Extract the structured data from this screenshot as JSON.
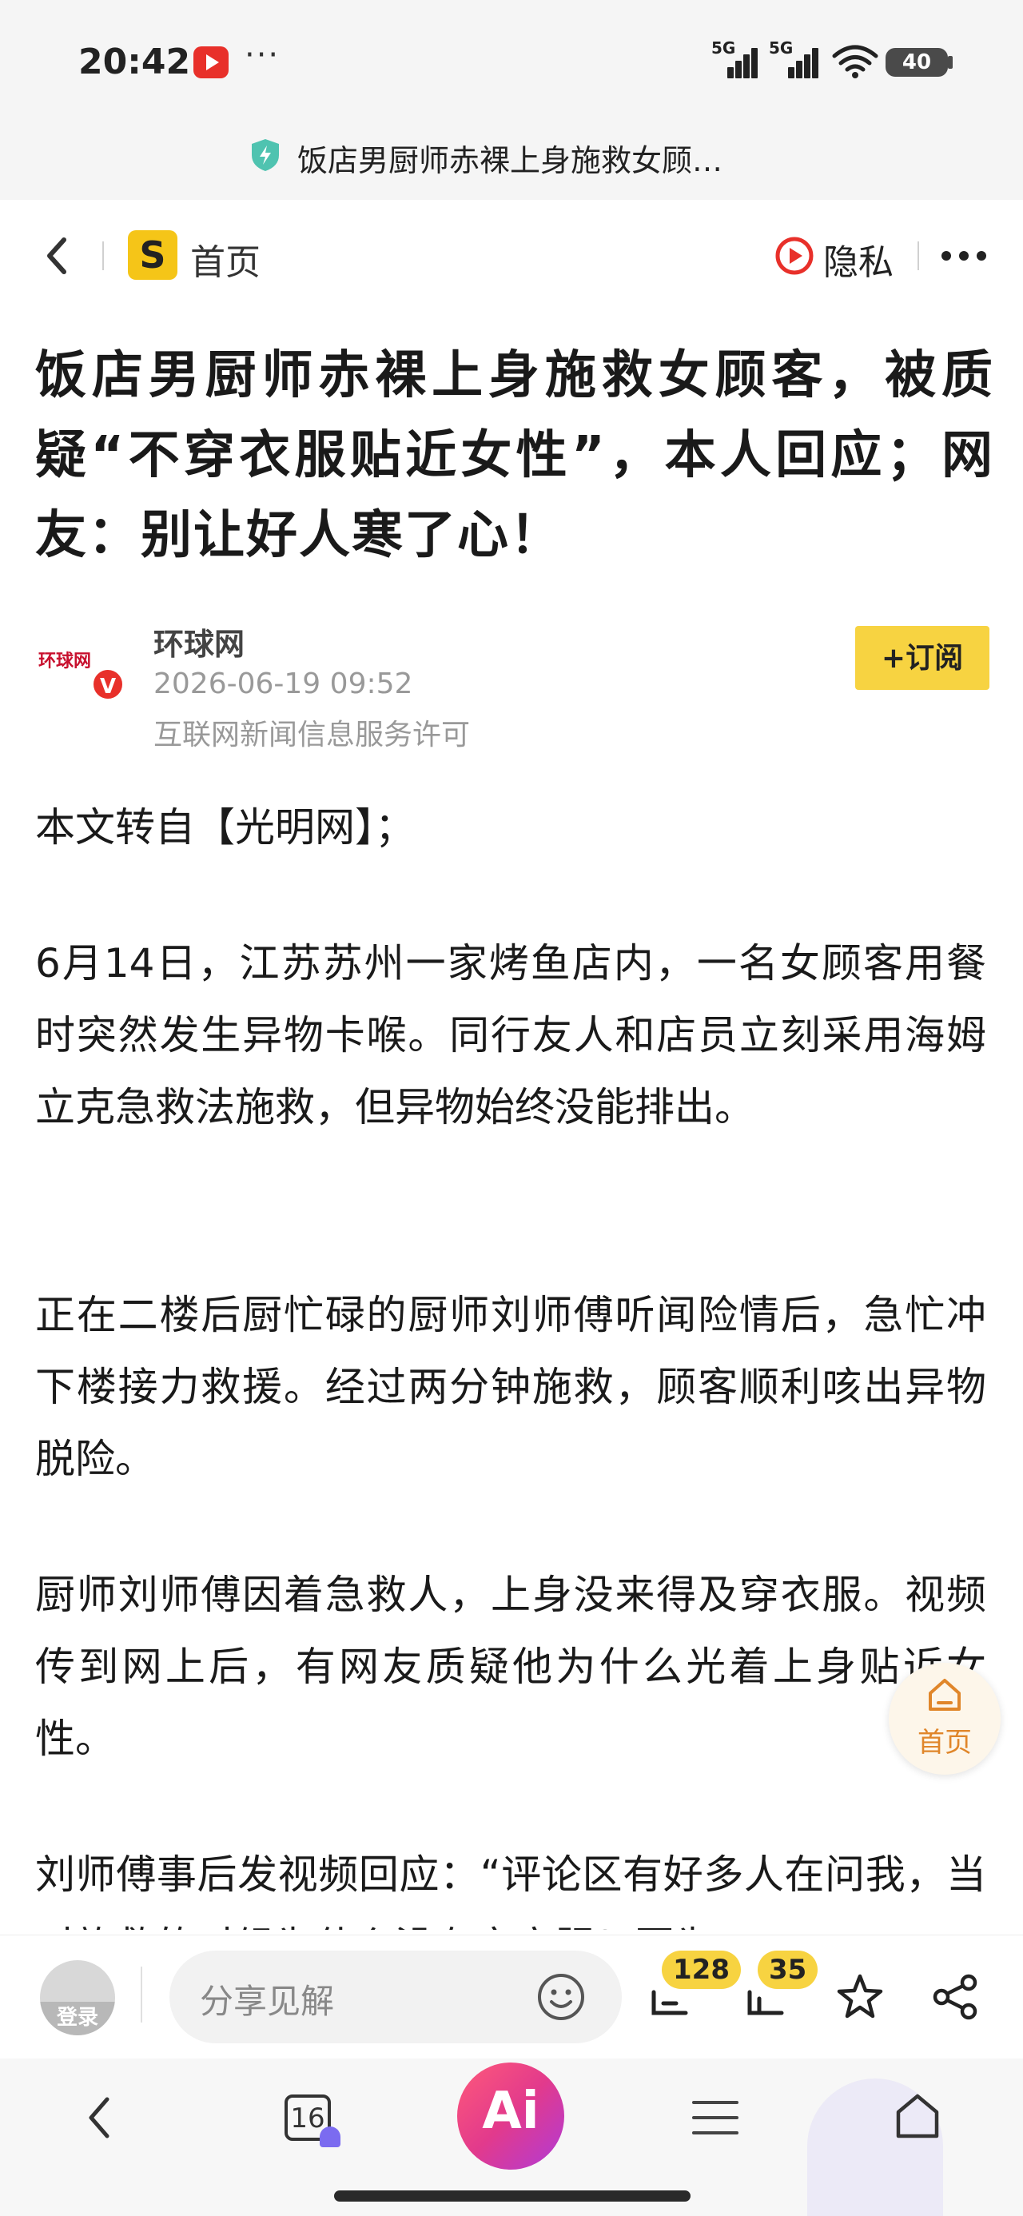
{
  "status_bar": {
    "time": "20:42",
    "more": "···",
    "signal_1_label": "5G",
    "signal_2_label": "5G",
    "battery": "40"
  },
  "url_bar": {
    "title": "饭店男厨师赤裸上身施救女顾…"
  },
  "nav": {
    "home_label": "首页",
    "privacy_label": "隐私"
  },
  "article": {
    "title": "饭店男厨师赤裸上身施救女顾客，被质疑“不穿衣服贴近女性”，本人回应；网友：别让好人寒了心！",
    "source": {
      "avatar_text": "环球网",
      "verified": "V",
      "name": "环球网",
      "time": "2026-06-19 09:52",
      "license": "互联网新闻信息服务许可"
    },
    "subscribe_label": "+订阅",
    "paragraphs": [
      "本文转自【光明网】；",
      "6月14日，江苏苏州一家烤鱼店内，一名女顾客用餐时突然发生异物卡喉。同行友人和店员立刻采用海姆立克急救法施救，但异物始终没能排出。",
      "正在二楼后厨忙碌的厨师刘师傅听闻险情后，急忙冲下楼接力救援。经过两分钟施救，顾客顺利咳出异物脱险。",
      "厨师刘师傅因着急救人，上身没来得及穿衣服。视频传到网上后，有网友质疑他为什么光着上身贴近女性。",
      "刘师傅事后发视频回应：“评论区有好多人在问我，当时施救的时候为什么没有穿衣服？因为"
    ]
  },
  "floating_home": {
    "label": "首页"
  },
  "comment_bar": {
    "login_label": "登录",
    "input_placeholder": "分享见解",
    "comments_count": "128",
    "likes_count": "35"
  },
  "browser_bar": {
    "tabs_count": "16",
    "ai_label": "Ai"
  },
  "colors": {
    "accent_yellow": "#f7d341",
    "brand_red": "#e8302a",
    "ai_gradient_start": "#ff5a7a",
    "ai_gradient_end": "#b03ad8",
    "floating_home_orange": "#e0862a"
  },
  "icons": [
    "notification-app-icon",
    "signal-icon",
    "wifi-icon",
    "battery-icon",
    "secure-shield-icon",
    "back-icon",
    "site-logo-icon",
    "privacy-icon",
    "more-menu-icon",
    "verified-badge",
    "home-icon",
    "emoji-icon",
    "comments-icon",
    "like-icon",
    "favorite-icon",
    "share-icon",
    "tabs-icon",
    "menu-icon"
  ]
}
